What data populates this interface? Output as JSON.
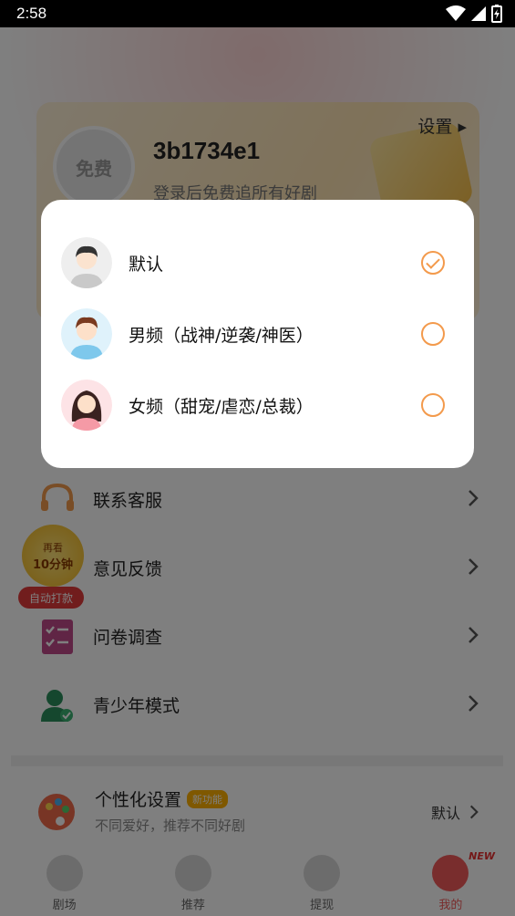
{
  "status_bar": {
    "time": "2:58"
  },
  "profile": {
    "avatar_text": "免费",
    "user_id": "3b1734e1",
    "login_tip": "登录后免费追所有好剧",
    "settings_label": "设置 ▸"
  },
  "menu": {
    "items": [
      {
        "label": "联系客服"
      },
      {
        "label": "意见反馈"
      },
      {
        "label": "问卷调查"
      },
      {
        "label": "青少年模式"
      }
    ]
  },
  "promo": {
    "line1": "再看",
    "line2": "10分钟",
    "pill": "自动打款"
  },
  "personalization": {
    "title": "个性化设置",
    "badge": "新功能",
    "subtitle": "不同爱好，推荐不同好剧",
    "current": "默认"
  },
  "tabs": [
    {
      "label": "剧场"
    },
    {
      "label": "推荐"
    },
    {
      "label": "提现"
    },
    {
      "label": "我的"
    }
  ],
  "new_tag": "NEW",
  "dialog": {
    "options": [
      {
        "label": "默认",
        "selected": true
      },
      {
        "label": "男频（战神/逆袭/神医）",
        "selected": false
      },
      {
        "label": "女频（甜宠/虐恋/总裁）",
        "selected": false
      }
    ]
  },
  "colors": {
    "accent": "#f39a4c",
    "active_tab": "#f25a5a"
  }
}
